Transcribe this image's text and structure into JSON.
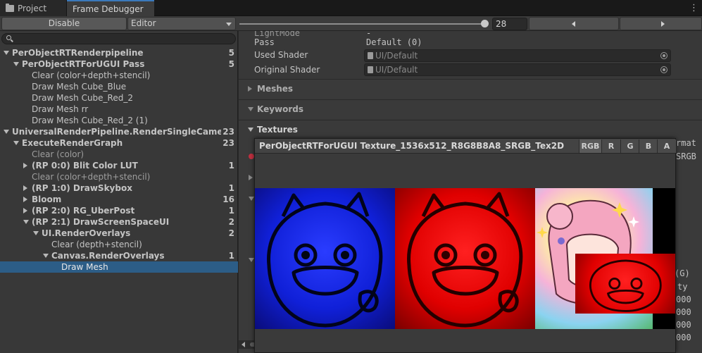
{
  "tabs": {
    "project": "Project",
    "frame_debugger": "Frame Debugger"
  },
  "toolbar": {
    "disable": "Disable",
    "mode": "Editor",
    "frame": "28"
  },
  "tree": [
    {
      "label": "PerObjectRTRenderpipeline",
      "count": "5",
      "indent": 0,
      "fold": "open",
      "bold": true
    },
    {
      "label": "PerObjectRTForUGUI Pass",
      "count": "5",
      "indent": 1,
      "fold": "open",
      "bold": true
    },
    {
      "label": "Clear (color+depth+stencil)",
      "count": "",
      "indent": 2,
      "fold": "",
      "bold": false
    },
    {
      "label": "Draw Mesh Cube_Blue",
      "count": "",
      "indent": 2,
      "fold": "",
      "bold": false
    },
    {
      "label": "Draw Mesh Cube_Red_2",
      "count": "",
      "indent": 2,
      "fold": "",
      "bold": false
    },
    {
      "label": "Draw Mesh rr",
      "count": "",
      "indent": 2,
      "fold": "",
      "bold": false
    },
    {
      "label": "Draw Mesh Cube_Red_2 (1)",
      "count": "",
      "indent": 2,
      "fold": "",
      "bold": false
    },
    {
      "label": "UniversalRenderPipeline.RenderSingleCameraInte",
      "count": "23",
      "indent": 0,
      "fold": "open",
      "bold": true
    },
    {
      "label": "ExecuteRenderGraph",
      "count": "23",
      "indent": 1,
      "fold": "open",
      "bold": true
    },
    {
      "label": "Clear (color)",
      "count": "",
      "indent": 2,
      "fold": "",
      "bold": false,
      "dim": true
    },
    {
      "label": "(RP 0:0) Blit Color LUT",
      "count": "1",
      "indent": 2,
      "fold": "closed",
      "bold": true
    },
    {
      "label": "Clear (color+depth+stencil)",
      "count": "",
      "indent": 2,
      "fold": "",
      "bold": false,
      "dim": true
    },
    {
      "label": "(RP 1:0) DrawSkybox",
      "count": "1",
      "indent": 2,
      "fold": "closed",
      "bold": true
    },
    {
      "label": "Bloom",
      "count": "16",
      "indent": 2,
      "fold": "closed",
      "bold": true
    },
    {
      "label": "(RP 2:0) RG_UberPost",
      "count": "1",
      "indent": 2,
      "fold": "closed",
      "bold": true
    },
    {
      "label": "(RP 2:1) DrawScreenSpaceUI",
      "count": "2",
      "indent": 2,
      "fold": "open",
      "bold": true
    },
    {
      "label": "UI.RenderOverlays",
      "count": "2",
      "indent": 3,
      "fold": "open",
      "bold": true
    },
    {
      "label": "Clear (depth+stencil)",
      "count": "",
      "indent": 4,
      "fold": "",
      "bold": false
    },
    {
      "label": "Canvas.RenderOverlays",
      "count": "1",
      "indent": 4,
      "fold": "open",
      "bold": true
    },
    {
      "label": "Draw Mesh",
      "count": "",
      "indent": 5,
      "fold": "",
      "bold": false,
      "selected": true
    }
  ],
  "inspector": {
    "lightmode_label": "LightMode",
    "lightmode_value": "-",
    "pass_label": "Pass",
    "pass_value": "Default (0)",
    "used_shader_label": "Used Shader",
    "used_shader_value": "UI/Default",
    "original_shader_label": "Original Shader",
    "original_shader_value": "UI/Default",
    "sections": {
      "meshes": "Meshes",
      "keywords": "Keywords",
      "textures": "Textures"
    },
    "partial_right": {
      "format": "rmat",
      "srgb": "SRGB",
      "g": "(G)",
      "ty": "ty",
      "n1": "000",
      "n2": "000",
      "n3": "000",
      "n4": "000"
    }
  },
  "popup": {
    "title": "PerObjectRTForUGUI Texture_1536x512_R8G8B8A8_SRGB_Tex2D",
    "channels": [
      "RGB",
      "R",
      "G",
      "B",
      "A"
    ],
    "active_channel": "RGB"
  },
  "colors": {
    "selection": "#2c5d87",
    "accent": "#3a79bb"
  }
}
